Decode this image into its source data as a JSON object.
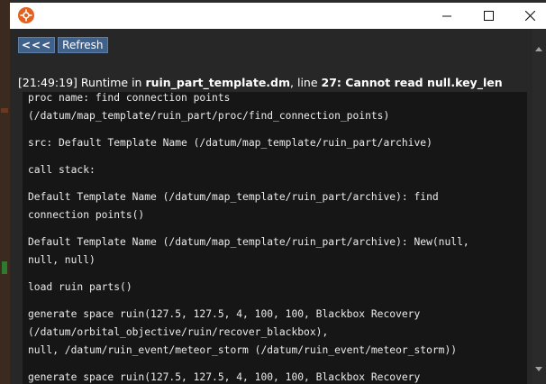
{
  "window": {
    "icon": "app-icon",
    "controls": {
      "minimize": "minimize-icon",
      "maximize": "maximize-icon",
      "close": "close-icon"
    }
  },
  "toolbar": {
    "back_label": "<<<",
    "refresh_label": "Refresh"
  },
  "error": {
    "timestamp": "[21:49:19]",
    "runtime_prefix": " Runtime in ",
    "file": "ruin_part_template.dm",
    "line_prefix": ", line ",
    "line": "27",
    "message": ": Cannot read null.key_len"
  },
  "trace_lines": [
    "proc name: find connection points",
    "(/datum/map_template/ruin_part/proc/find_connection_points)",
    "src: Default Template Name (/datum/map_template/ruin_part/archive)",
    "call stack:",
    "Default Template Name (/datum/map_template/ruin_part/archive): find",
    "connection points()",
    "Default Template Name (/datum/map_template/ruin_part/archive): New(null,",
    "null, null)",
    "load ruin parts()",
    "generate space ruin(127.5, 127.5, 4, 100, 100, Blackbox Recovery",
    "(/datum/orbital_objective/ruin/recover_blackbox),",
    "null, /datum/ruin_event/meteor_storm (/datum/ruin_event/meteor_storm))",
    "generate space ruin(127.5, 127.5, 4, 100, 100, Blackbox Recovery"
  ],
  "colors": {
    "accent_button": "#40628a",
    "background": "#272727",
    "trace_background": "#161616",
    "text": "#ffffff"
  }
}
